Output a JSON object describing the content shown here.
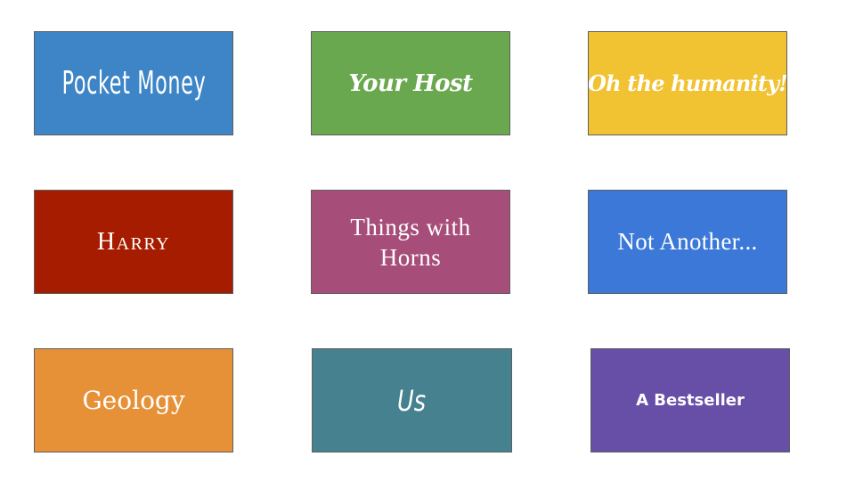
{
  "tiles": [
    {
      "label": "Pocket Money",
      "color": "#3d85c6"
    },
    {
      "label": "Your Host",
      "color": "#6aa84f"
    },
    {
      "label": "Oh the humanity!",
      "color": "#f1c232"
    },
    {
      "label": "Harry",
      "color": "#a61c00"
    },
    {
      "label": "Things with Horns",
      "color": "#a64d79"
    },
    {
      "label": "Not Another...",
      "color": "#3c78d8"
    },
    {
      "label": "Geology",
      "color": "#e69138"
    },
    {
      "label": "Us",
      "color": "#45818e"
    },
    {
      "label": "A Bestseller",
      "color": "#674ea7"
    }
  ]
}
